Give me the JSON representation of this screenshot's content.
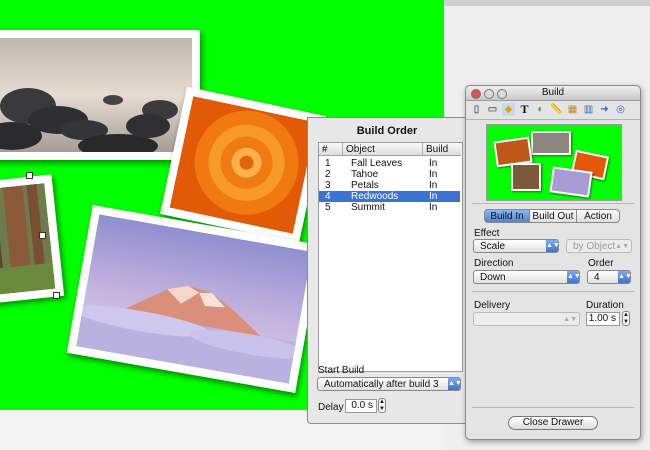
{
  "build_order": {
    "title": "Build Order",
    "columns": [
      "#",
      "Object",
      "Build"
    ],
    "rows": [
      {
        "num": "1",
        "object": "Fall Leaves",
        "build": "In"
      },
      {
        "num": "2",
        "object": "Tahoe",
        "build": "In"
      },
      {
        "num": "3",
        "object": "Petals",
        "build": "In"
      },
      {
        "num": "4",
        "object": "Redwoods",
        "build": "In"
      },
      {
        "num": "5",
        "object": "Summit",
        "build": "In"
      }
    ],
    "selected_row": 3,
    "start_build_label": "Start Build",
    "start_build_value": "Automatically after build 3",
    "delay_label": "Delay",
    "delay_value": "0.0 s"
  },
  "inspector": {
    "title": "Build",
    "tabs": [
      "Build In",
      "Build Out",
      "Action"
    ],
    "active_tab": 0,
    "effect_label": "Effect",
    "effect_value": "Scale",
    "by_object_value": "by Object",
    "direction_label": "Direction",
    "direction_value": "Down",
    "order_label": "Order",
    "order_value": "4",
    "delivery_label": "Delivery",
    "delivery_value": "",
    "duration_label": "Duration",
    "duration_value": "1.00 s",
    "close_button": "Close Drawer",
    "toolbar_icons": [
      "document-icon",
      "slide-icon",
      "build-icon",
      "text-icon",
      "graphic-icon",
      "metrics-icon",
      "table-icon",
      "chart-icon",
      "hyperlink-icon",
      "quicktime-icon"
    ]
  },
  "colors": {
    "slide_background": "#00ff00",
    "selection": "#3b73d4"
  }
}
